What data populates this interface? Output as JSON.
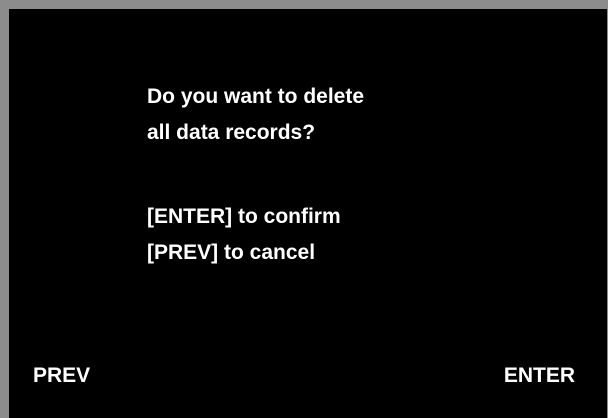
{
  "dialog": {
    "question_line1": "Do you want to delete",
    "question_line2": "all data records?",
    "instruction_confirm": "[ENTER] to confirm",
    "instruction_cancel": "[PREV] to cancel"
  },
  "softkeys": {
    "left_label": "PREV",
    "right_label": "ENTER"
  },
  "colors": {
    "screen_background": "#000000",
    "text": "#ffffff",
    "bezel": "#8c8c8c"
  }
}
